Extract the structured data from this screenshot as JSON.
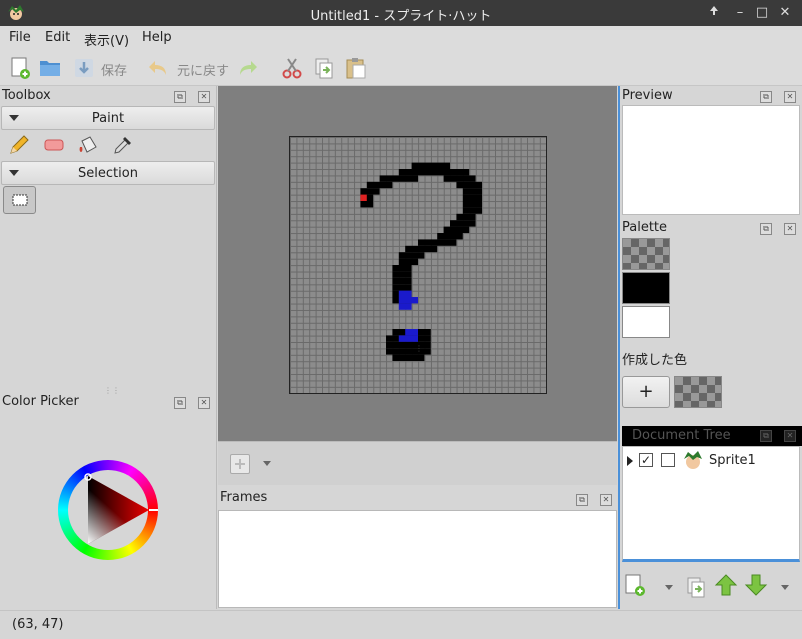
{
  "window": {
    "title": "Untitled1 - スプライト·ハット",
    "controls": {
      "maximize_icon": "arrow-up-icon",
      "minimize": "–",
      "restore": "□",
      "close": "✕"
    }
  },
  "menubar": {
    "items": [
      "File",
      "Edit",
      "表示(V)",
      "Help"
    ]
  },
  "toolbar": {
    "save_label": "保存",
    "undo_label": "元に戻す"
  },
  "toolbox": {
    "title": "Toolbox",
    "paint_group": "Paint",
    "selection_group": "Selection",
    "tools": [
      "pencil-icon",
      "eraser-icon",
      "fill-bucket-icon",
      "eyedropper-icon"
    ]
  },
  "color_picker": {
    "title": "Color Picker"
  },
  "frames": {
    "title": "Frames"
  },
  "preview": {
    "title": "Preview"
  },
  "palette": {
    "title": "Palette",
    "custom_colors_label": "作成した色",
    "add_label": "+",
    "swatches": [
      "transparent",
      "#000000",
      "#ffffff"
    ]
  },
  "document_tree": {
    "title": "Document Tree",
    "items": [
      {
        "label": "Sprite1",
        "checked": true
      }
    ]
  },
  "status": {
    "coords": "(63, 47)"
  }
}
